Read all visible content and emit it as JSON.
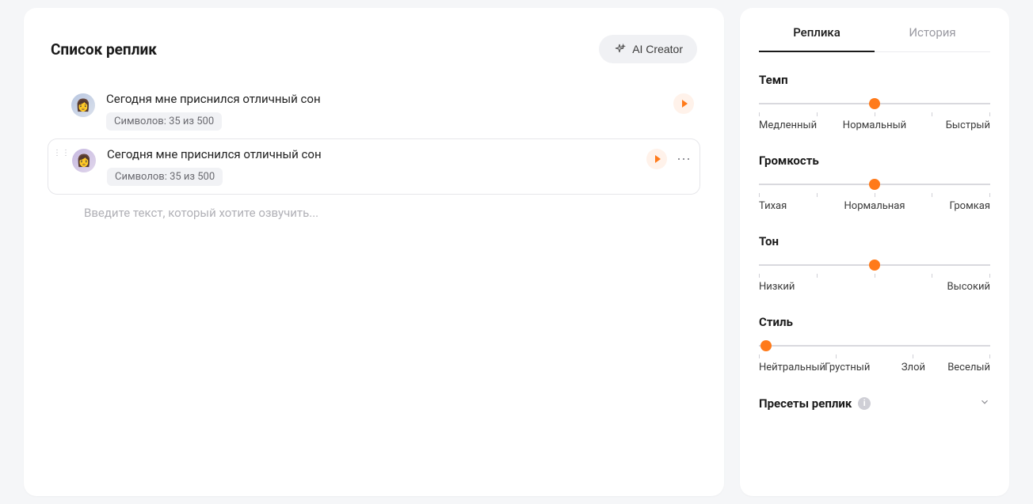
{
  "main": {
    "title": "Список реплик",
    "ai_creator_label": "AI Creator",
    "placeholder": "Введите текст, который хотите озвучить...",
    "replicas": [
      {
        "text": "Сегодня мне приснился отличный сон",
        "char_label": "Символов: 35 из 500",
        "selected": false,
        "avatar_emoji": "👩"
      },
      {
        "text": "Сегодня мне приснился отличный сон",
        "char_label": "Символов: 35 из 500",
        "selected": true,
        "avatar_emoji": "👩"
      }
    ]
  },
  "side": {
    "tabs": {
      "replica": "Реплика",
      "history": "История"
    },
    "sliders": {
      "tempo": {
        "title": "Темп",
        "labels": [
          "Медленный",
          "Нормальный",
          "Быстрый"
        ],
        "thumb_pct": 50
      },
      "volume": {
        "title": "Громкость",
        "labels": [
          "Тихая",
          "Нормальная",
          "Громкая"
        ],
        "thumb_pct": 50
      },
      "tone": {
        "title": "Тон",
        "labels": [
          "Низкий",
          "Высокий"
        ],
        "thumb_pct": 50
      },
      "style": {
        "title": "Стиль",
        "labels": [
          "Нейтральный",
          "Грустный",
          "Злой",
          "Веселый"
        ],
        "thumb_pct": 3
      }
    },
    "presets": {
      "title": "Пресеты реплик"
    }
  },
  "colors": {
    "accent": "#ff7a1a"
  }
}
